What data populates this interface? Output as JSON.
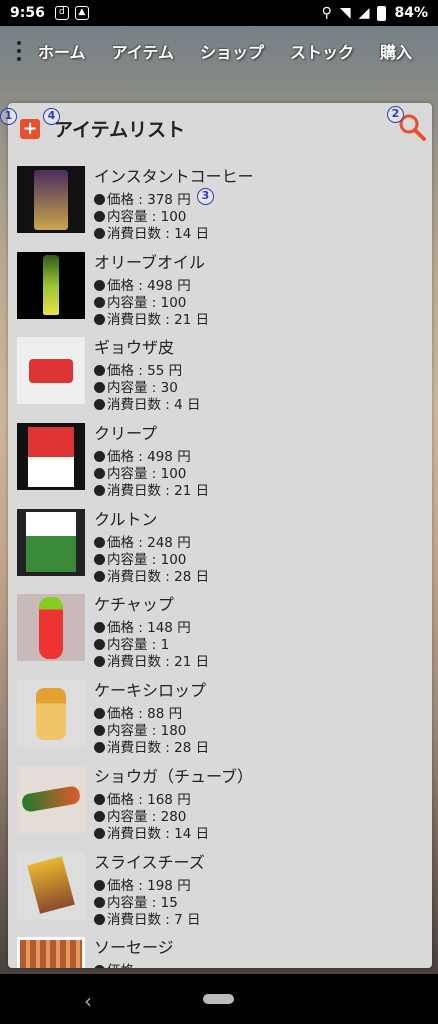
{
  "status": {
    "time": "9:56",
    "battery": "84%"
  },
  "tabs": [
    "ホーム",
    "アイテム",
    "ショップ",
    "ストック",
    "購入"
  ],
  "panel": {
    "title": "アイテムリスト"
  },
  "badges": {
    "add": "1",
    "search": "2",
    "price": "3",
    "title": "4"
  },
  "labels": {
    "price": "価格 : ",
    "content": "内容量 : ",
    "days": "消費日数 : ",
    "yen": " 円",
    "day_unit": " 日"
  },
  "items": [
    {
      "name": "インスタントコーヒー",
      "price": "378",
      "content": "100",
      "days": "14"
    },
    {
      "name": "オリーブオイル",
      "price": "498",
      "content": "100",
      "days": "21"
    },
    {
      "name": "ギョウザ皮",
      "price": "55",
      "content": "30",
      "days": "4"
    },
    {
      "name": "クリープ",
      "price": "498",
      "content": "100",
      "days": "21"
    },
    {
      "name": "クルトン",
      "price": "248",
      "content": "100",
      "days": "28"
    },
    {
      "name": "ケチャップ",
      "price": "148",
      "content": "1",
      "days": "21"
    },
    {
      "name": "ケーキシロップ",
      "price": "88",
      "content": "180",
      "days": "28"
    },
    {
      "name": "ショウガ（チューブ）",
      "price": "168",
      "content": "280",
      "days": "14"
    },
    {
      "name": "スライスチーズ",
      "price": "198",
      "content": "15",
      "days": "7"
    },
    {
      "name": "ソーセージ",
      "price": "",
      "content": "",
      "days": ""
    }
  ],
  "colors": {
    "accent": "#e94f2a",
    "badge": "#2a3fb8"
  }
}
